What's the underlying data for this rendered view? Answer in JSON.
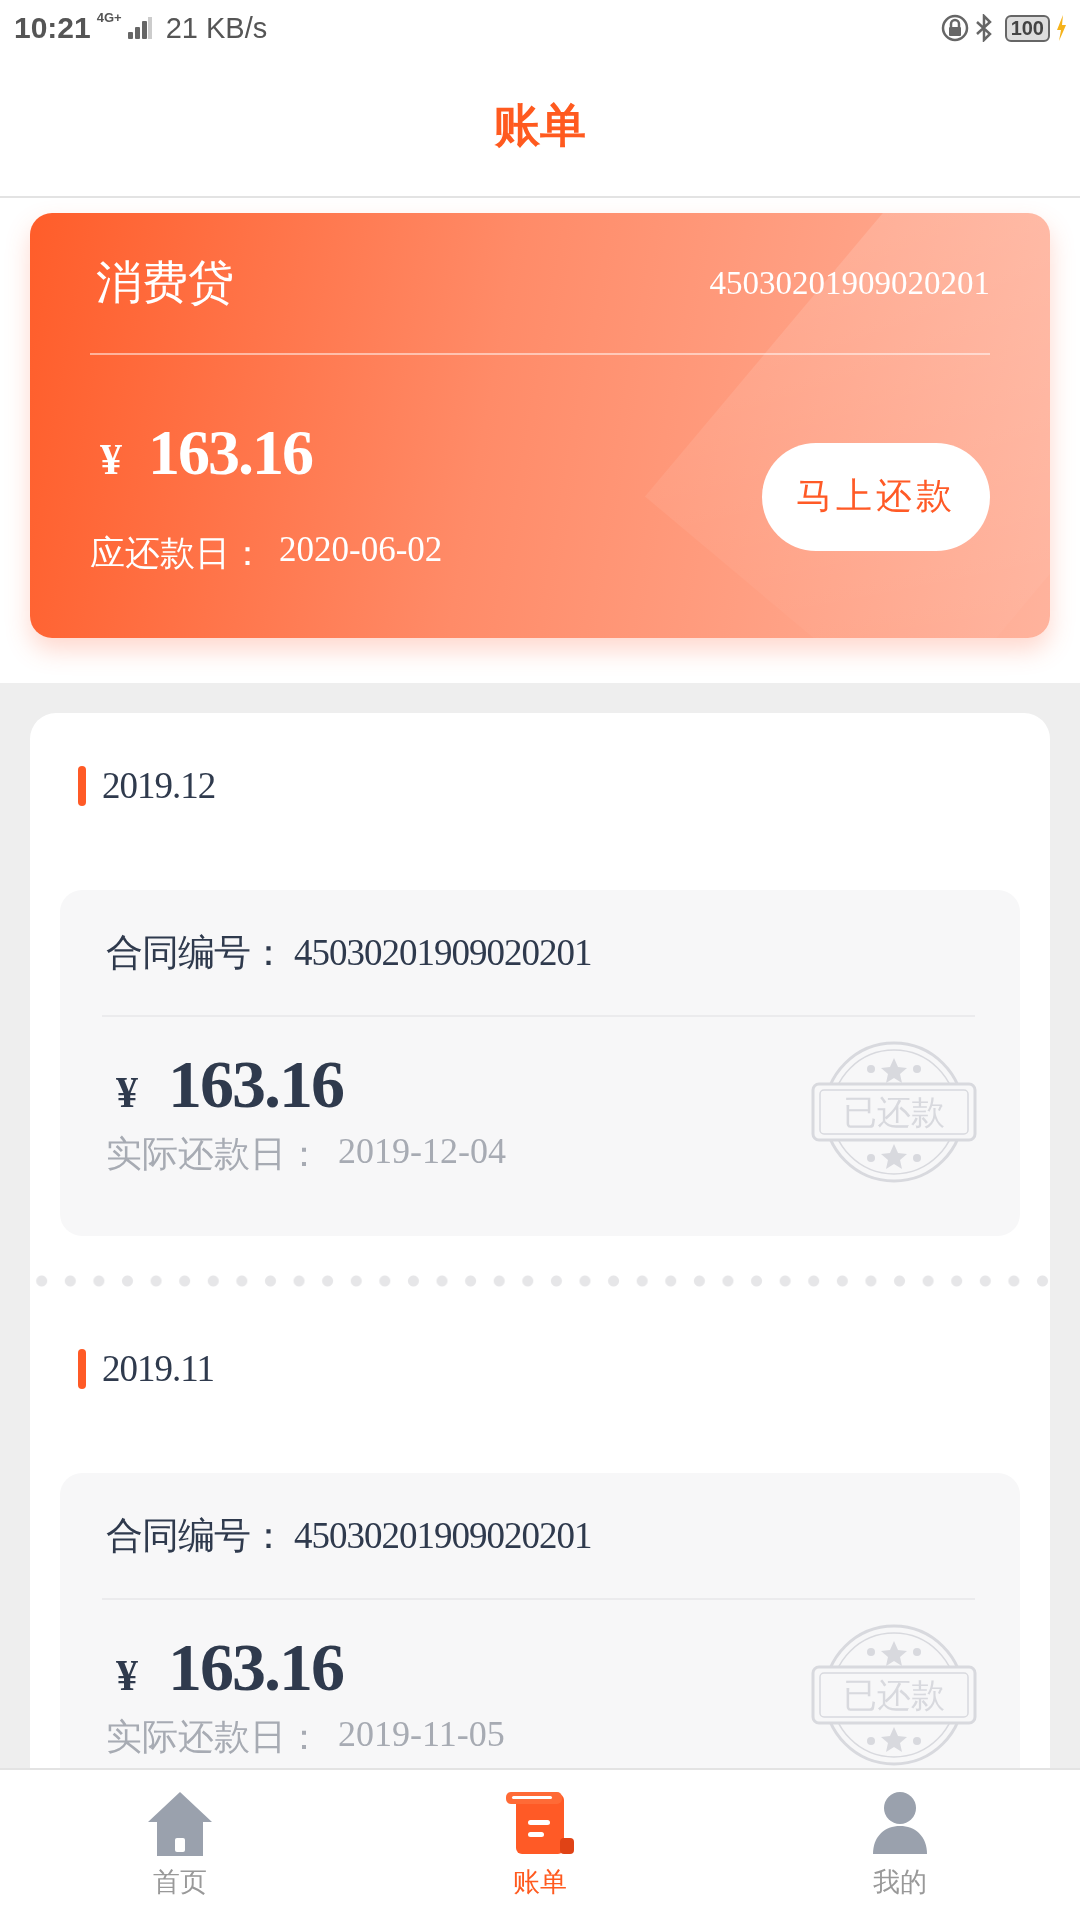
{
  "status_bar": {
    "time": "10:21",
    "network": "4G+",
    "speed": "21 KB/s",
    "battery": "100"
  },
  "header": {
    "title": "账单"
  },
  "loan_card": {
    "title": "消费贷",
    "number": "45030201909020201",
    "currency": "¥",
    "amount": "163.16",
    "button": "马上还款",
    "due_label": "应还款日：",
    "due_date": "2020-06-02"
  },
  "bills": [
    {
      "month": "2019.12",
      "contract_label": "合同编号：",
      "contract_number": "45030201909020201",
      "currency": "¥",
      "amount": "163.16",
      "paid_label": "实际还款日：",
      "paid_date": "2019-12-04",
      "stamp": "已还款"
    },
    {
      "month": "2019.11",
      "contract_label": "合同编号：",
      "contract_number": "45030201909020201",
      "currency": "¥",
      "amount": "163.16",
      "paid_label": "实际还款日：",
      "paid_date": "2019-11-05",
      "stamp": "已还款"
    }
  ],
  "nav": [
    {
      "kind": "home",
      "label": "首页",
      "selected": false
    },
    {
      "kind": "bill",
      "label": "账单",
      "selected": true
    },
    {
      "kind": "user",
      "label": "我的",
      "selected": false
    }
  ]
}
